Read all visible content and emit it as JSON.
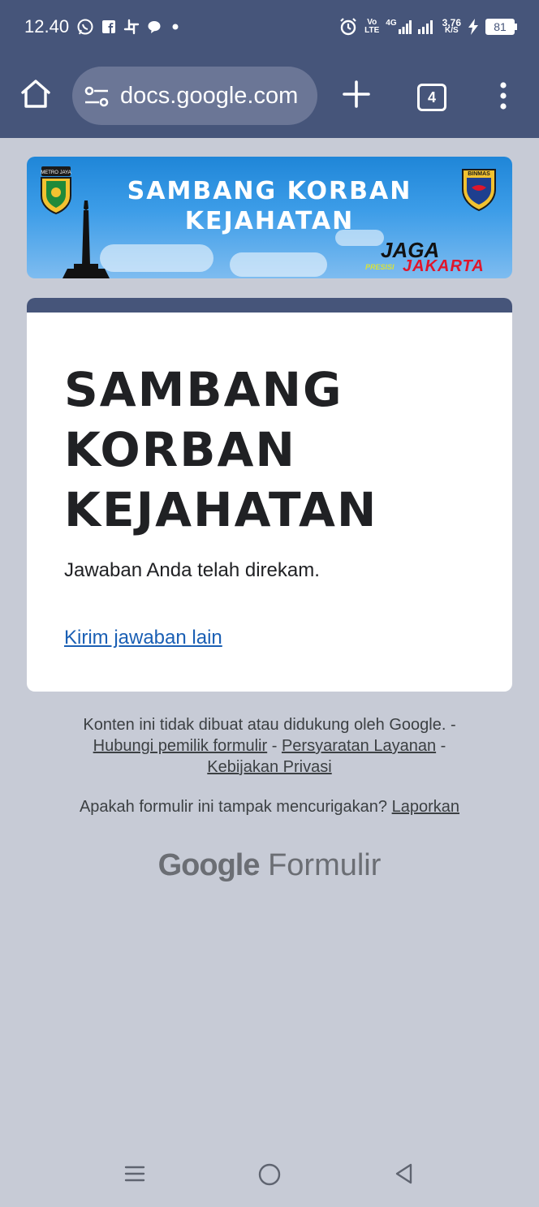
{
  "status_bar": {
    "time": "12.40",
    "volte_top": "Vo",
    "volte_bottom": "LTE",
    "network": "4G",
    "speed_top": "3,76",
    "speed_bottom": "K/S",
    "battery": "81"
  },
  "browser": {
    "url": "docs.google.com",
    "tab_count": "4"
  },
  "banner": {
    "line1": "SAMBANG KORBAN",
    "line2": "KEJAHATAN",
    "jaga": "JAGA",
    "jakarta": "JAKARTA",
    "presisi": "PRESISI",
    "badge_left": "METRO JAYA",
    "badge_right": "BINMAS"
  },
  "form": {
    "title_line1": "SAMBANG",
    "title_line2": "KORBAN",
    "title_line3": "KEJAHATAN",
    "confirmation": "Jawaban Anda telah direkam.",
    "submit_another": "Kirim jawaban lain"
  },
  "footer": {
    "disclaimer": "Konten ini tidak dibuat atau didukung oleh Google. -",
    "contact_owner": "Hubungi pemilik formulir",
    "separator": "-",
    "terms": "Persyaratan Layanan",
    "privacy": "Kebijakan Privasi",
    "suspicious": "Apakah formulir ini tampak mencurigakan?",
    "report": "Laporkan",
    "brand_google": "Google",
    "brand_forms": "Formulir"
  },
  "icons": {
    "home": "home-icon",
    "tune": "site-settings-icon",
    "add": "plus-icon",
    "menu": "more-vert-icon",
    "nav_recents": "recents-icon",
    "nav_home": "circle-home-icon",
    "nav_back": "back-triangle-icon"
  },
  "colors": {
    "toolbar": "#46557a",
    "page_bg": "#c7cbd6",
    "link": "#1a5fb4",
    "banner_jakarta": "#e0162b"
  }
}
